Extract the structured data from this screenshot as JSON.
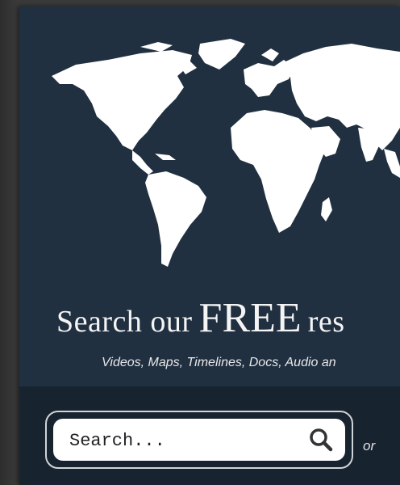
{
  "hero": {
    "headline_pre": "Search our",
    "headline_free": "FREE",
    "headline_post": "res",
    "subline": "Videos, Maps, Timelines, Docs, Audio an",
    "map_icon": "world-map-icon"
  },
  "search": {
    "placeholder": "Search...",
    "button_icon": "search-icon",
    "or_label": "or"
  },
  "colors": {
    "card_bg": "#203040",
    "band_bg": "#182330",
    "text": "#f4f4f4"
  }
}
